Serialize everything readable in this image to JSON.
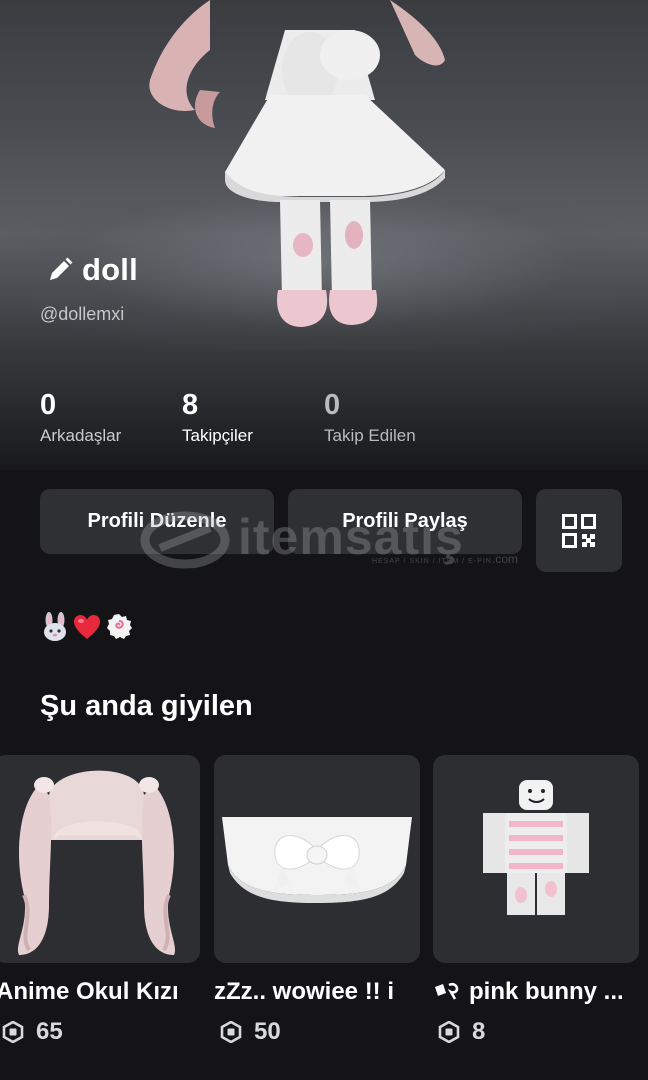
{
  "profile": {
    "display_name": "doll",
    "username": "@dollemxi",
    "bio_emojis": [
      "rabbit-face",
      "red-heart",
      "fish-cake"
    ]
  },
  "stats": [
    {
      "value": "0",
      "label": "Arkadaşlar"
    },
    {
      "value": "8",
      "label": "Takipçiler"
    },
    {
      "value": "0",
      "label": "Takip Edilen"
    }
  ],
  "actions": {
    "edit_profile": "Profili Düzenle",
    "share_profile": "Profili Paylaş"
  },
  "watermark": {
    "text": "itemsatış",
    "sub": "HESAP / SKIN / ITEM / E-PIN",
    "domain": ".com"
  },
  "wearing": {
    "title": "Şu anda giyilen",
    "items": [
      {
        "name": "Anime Okul Kızı",
        "price": "65"
      },
      {
        "name": "zZz.. wowiee !! i",
        "price": "50"
      },
      {
        "name": "pink bunny ...",
        "price": "8"
      }
    ]
  },
  "colors": {
    "background": "#141416",
    "card": "#2d2e32",
    "button": "#2f3034"
  }
}
